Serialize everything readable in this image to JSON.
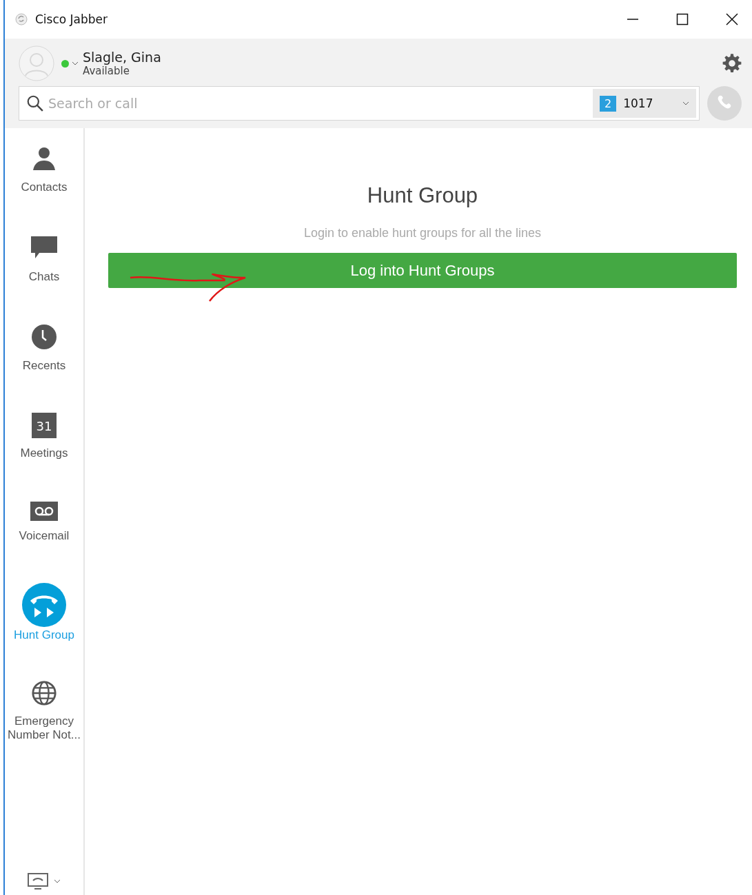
{
  "window": {
    "title": "Cisco Jabber"
  },
  "user": {
    "name": "Slagle, Gina",
    "status": "Available"
  },
  "search": {
    "placeholder": "Search or call",
    "line_badge": "2",
    "line_number": "1017"
  },
  "sidebar": {
    "items": [
      {
        "kind": "contacts",
        "label": "Contacts",
        "selected": false
      },
      {
        "kind": "chats",
        "label": "Chats",
        "selected": false
      },
      {
        "kind": "recents",
        "label": "Recents",
        "selected": false
      },
      {
        "kind": "meetings",
        "label": "Meetings",
        "icon_text": "31",
        "selected": false
      },
      {
        "kind": "voicemail",
        "label": "Voicemail",
        "selected": false
      },
      {
        "kind": "huntgroup",
        "label": "Hunt Group",
        "selected": true
      },
      {
        "kind": "emergency",
        "label": "Emergency Number Not...",
        "selected": false
      }
    ]
  },
  "main": {
    "title": "Hunt Group",
    "subtitle": "Login to enable hunt groups for all the lines",
    "button": "Log into Hunt Groups"
  }
}
